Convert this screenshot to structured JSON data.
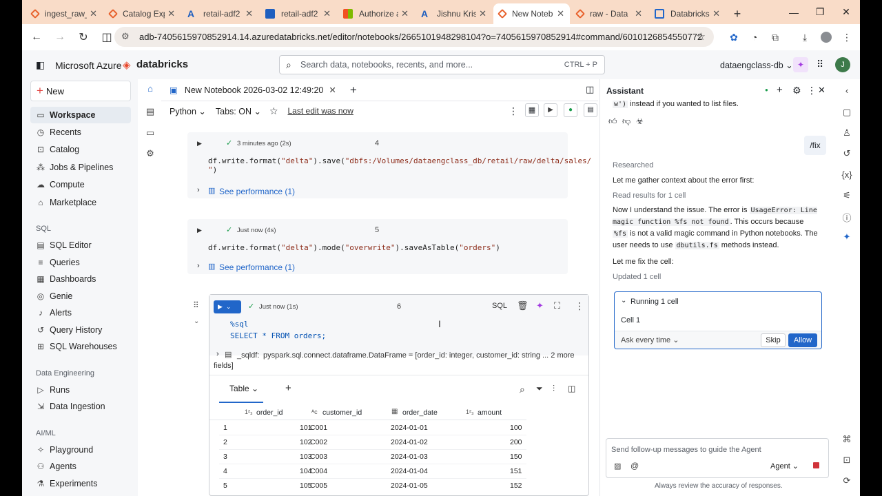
{
  "browser": {
    "tabs": [
      {
        "label": "ingest_raw_",
        "color": "#e8612c"
      },
      {
        "label": "Catalog Exp",
        "color": "#e8612c"
      },
      {
        "label": "retail-adf2",
        "color": "#1f5fbf"
      },
      {
        "label": "retail-adf2",
        "color": "#1f5fbf"
      },
      {
        "label": "Authorize a",
        "color": "#7fba00"
      },
      {
        "label": "Jishnu Krish",
        "color": "#1f5fbf"
      },
      {
        "label": "New Noteb",
        "color": "#e8612c"
      },
      {
        "label": "raw - Data",
        "color": "#e8612c"
      },
      {
        "label": "Databricks",
        "color": "#2166c9"
      }
    ],
    "url": "adb-7405615970852914.14.azuredatabricks.net/editor/notebooks/2665101948298104?o=7405615970852914#command/6010126854550772"
  },
  "header": {
    "microsoft": "Microsoft Azure",
    "databricks": "databricks",
    "search_placeholder": "Search data, notebooks, recents, and more...",
    "search_shortcut": "CTRL + P",
    "workspace": "dataengclass-db",
    "avatar": "J"
  },
  "sidebar": {
    "new": "New",
    "top": [
      "Workspace",
      "Recents",
      "Catalog",
      "Jobs & Pipelines",
      "Compute",
      "Marketplace"
    ],
    "sql_head": "SQL",
    "sql": [
      "SQL Editor",
      "Queries",
      "Dashboards",
      "Genie",
      "Alerts",
      "Query History",
      "SQL Warehouses"
    ],
    "de_head": "Data Engineering",
    "de": [
      "Runs",
      "Data Ingestion"
    ],
    "ai_head": "AI/ML",
    "ai": [
      "Playground",
      "Agents",
      "Experiments"
    ]
  },
  "notebook": {
    "title": "New Notebook 2026-03-02 12:49:20",
    "language": "Python",
    "tabs_setting": "Tabs: ON",
    "last_edit": "Last edit was now",
    "cell4": {
      "status": "3 minutes ago (2s)",
      "num": "4",
      "perf": "See performance (1)"
    },
    "cell5": {
      "status": "Just now (4s)",
      "num": "5",
      "perf": "See performance (1)"
    },
    "cell6": {
      "status": "Just now (1s)",
      "num": "6",
      "lang_badge": "SQL",
      "line1": "%sql",
      "line2": "SELECT * FROM orders;",
      "df_name": "_sqldf:",
      "df_desc": "pyspark.sql.connect.dataframe.DataFrame = [order_id: integer, customer_id: string ... 2 more",
      "df_desc2": "fields]",
      "table_tab": "Table"
    }
  },
  "table": {
    "columns": [
      "order_id",
      "customer_id",
      "order_date",
      "amount"
    ],
    "rows": [
      [
        "1",
        "101",
        "C001",
        "2024-01-01",
        "100"
      ],
      [
        "2",
        "102",
        "C002",
        "2024-01-02",
        "200"
      ],
      [
        "3",
        "103",
        "C003",
        "2024-01-03",
        "150"
      ],
      [
        "4",
        "104",
        "C004",
        "2024-01-04",
        "151"
      ],
      [
        "5",
        "105",
        "C005",
        "2024-01-05",
        "152"
      ]
    ]
  },
  "assistant": {
    "title": "Assistant",
    "prev_tail": "instead if you wanted to list files.",
    "prev_code": "w')",
    "user_msg": "/fix",
    "researched": "Researched",
    "gather": "Let me gather context about the error first:",
    "read": "Read results for 1 cell",
    "p1": "Now I understand the issue. The error is",
    "p1_code": "UsageError: Line magic function %fs not found",
    "p1b": ". This occurs because",
    "p1_code2": "%fs",
    "p1c": "is not a valid magic command in Python notebooks. The user needs to use",
    "p1_code3": "dbutils.fs",
    "p1d": "methods instead.",
    "fix": "Let me fix the cell:",
    "updated": "Updated 1 cell",
    "running": "Running 1 cell",
    "cell": "Cell 1",
    "ask": "Ask every time",
    "skip": "Skip",
    "allow": "Allow",
    "input_placeholder": "Send follow-up messages to guide the Agent",
    "agent": "Agent",
    "disclaimer": "Always review the accuracy of responses."
  }
}
